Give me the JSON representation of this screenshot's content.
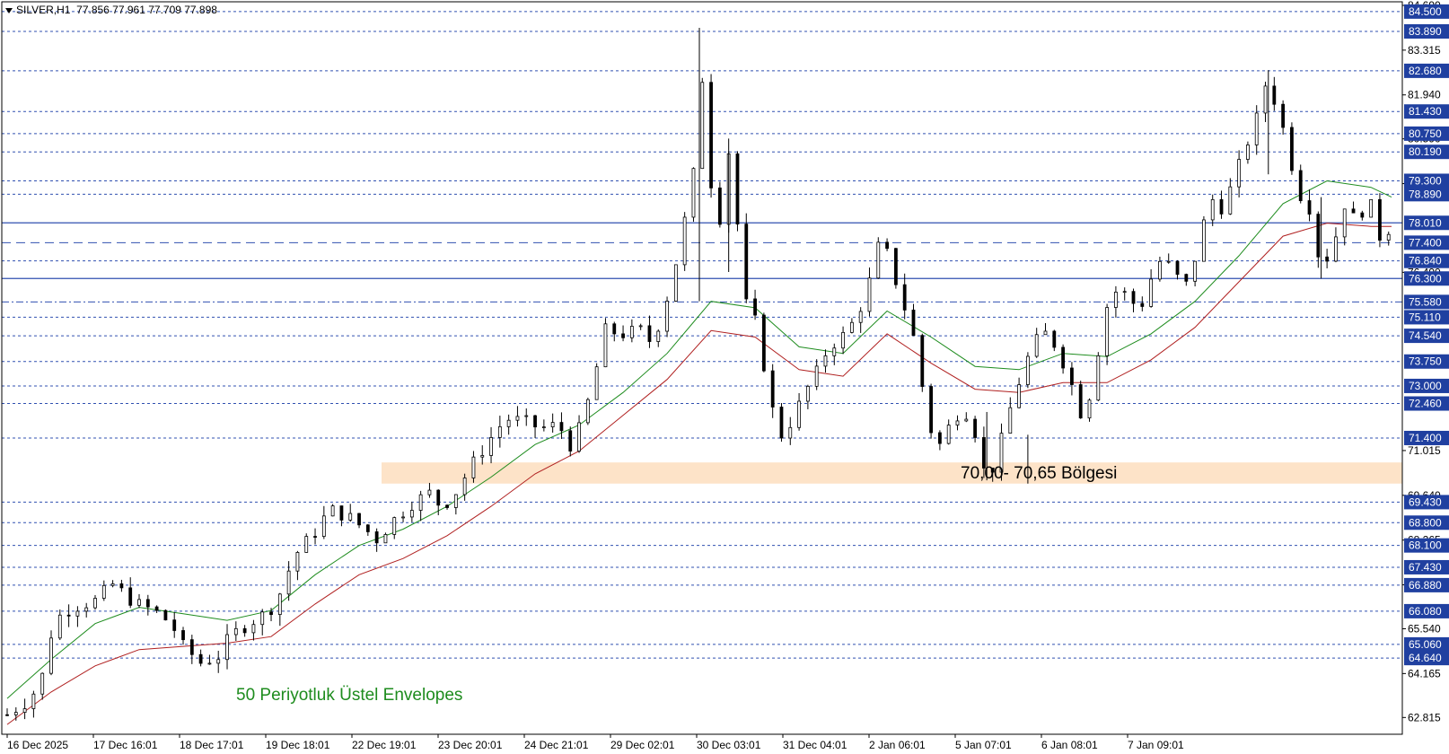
{
  "header": {
    "symbol": "SILVER,H1",
    "ohlc": "77.856 77.961 77.709 77.898"
  },
  "annotations": {
    "zone_label": "70,00- 70,65 Bölgesi",
    "envelope_label": "50 Periyotluk Üstel Envelopes"
  },
  "colors": {
    "grid_line": "#3050b0",
    "label_bg": "#2040a0",
    "zone_fill": "#fde3c8",
    "envelope_upper": "#1e8c1e",
    "envelope_lower": "#b02020",
    "candle": "#000000",
    "annotation_green": "#1e8c1e"
  },
  "chart_data": {
    "type": "candlestick",
    "instrument": "SILVER",
    "timeframe": "H1",
    "ylim": [
      62.3,
      84.8
    ],
    "x_ticks": [
      "16 Dec 2025",
      "17 Dec 16:01",
      "18 Dec 17:01",
      "19 Dec 18:01",
      "22 Dec 19:01",
      "23 Dec 20:01",
      "24 Dec 21:01",
      "29 Dec 02:01",
      "30 Dec 03:01",
      "31 Dec 04:01",
      "2 Jan 06:01",
      "5 Jan 07:01",
      "6 Jan 08:01",
      "7 Jan 09:01"
    ],
    "y_ticks": [
      "84.690",
      "83.315",
      "81.940",
      "80.590",
      "79.215",
      "76.490",
      "71.015",
      "69.640",
      "68.265",
      "66.890",
      "65.540",
      "64.165",
      "62.815"
    ],
    "level_labels": [
      "84.500",
      "83.890",
      "82.680",
      "81.430",
      "80.750",
      "80.190",
      "79.300",
      "78.890",
      "78.010",
      "77.400",
      "76.840",
      "76.300",
      "75.580",
      "75.110",
      "74.540",
      "73.750",
      "73.000",
      "72.460",
      "71.400",
      "69.430",
      "68.800",
      "68.100",
      "67.430",
      "66.880",
      "66.080",
      "65.060",
      "64.640"
    ],
    "dashed_levels": [
      84.5,
      83.89,
      82.68,
      81.43,
      80.75,
      80.19,
      79.3,
      78.89,
      77.4,
      76.84,
      75.58,
      75.11,
      74.54,
      73.75,
      73.0,
      72.46,
      71.4,
      69.43,
      68.8,
      68.1,
      67.43,
      66.88,
      66.08,
      65.06,
      64.64
    ],
    "solid_levels": [
      78.01,
      76.3
    ],
    "long_dash_levels": [
      77.4
    ],
    "dash_dot_levels": [
      75.58
    ],
    "support_zone": {
      "low": 70.0,
      "high": 70.65
    },
    "key_points": [
      [
        0,
        62.9
      ],
      [
        8,
        63.4
      ],
      [
        12,
        64.1
      ],
      [
        16,
        65.8
      ],
      [
        22,
        66.2
      ],
      [
        30,
        66.4
      ],
      [
        36,
        66.9
      ],
      [
        44,
        66.3
      ],
      [
        50,
        66.1
      ],
      [
        56,
        65.7
      ],
      [
        60,
        65.0
      ],
      [
        66,
        64.5
      ],
      [
        72,
        64.7
      ],
      [
        76,
        65.3
      ],
      [
        82,
        65.7
      ],
      [
        88,
        66.0
      ],
      [
        92,
        66.4
      ],
      [
        98,
        67.8
      ],
      [
        104,
        68.4
      ],
      [
        110,
        69.2
      ],
      [
        116,
        69.0
      ],
      [
        122,
        68.6
      ],
      [
        126,
        68.3
      ],
      [
        132,
        68.9
      ],
      [
        138,
        69.4
      ],
      [
        144,
        69.7
      ],
      [
        148,
        69.3
      ],
      [
        152,
        69.6
      ],
      [
        158,
        70.5
      ],
      [
        164,
        71.3
      ],
      [
        170,
        72.0
      ],
      [
        176,
        71.9
      ],
      [
        182,
        71.7
      ],
      [
        188,
        71.8
      ],
      [
        192,
        71.2
      ],
      [
        196,
        71.8
      ],
      [
        200,
        73.2
      ],
      [
        204,
        74.7
      ],
      [
        210,
        74.6
      ],
      [
        216,
        74.7
      ],
      [
        220,
        74.3
      ],
      [
        226,
        76.0
      ],
      [
        230,
        77.6
      ],
      [
        234,
        79.5
      ],
      [
        236,
        83.9
      ],
      [
        238,
        81.0
      ],
      [
        242,
        77.5
      ],
      [
        246,
        80.2
      ],
      [
        248,
        78.8
      ],
      [
        252,
        75.5
      ],
      [
        256,
        74.8
      ],
      [
        260,
        72.5
      ],
      [
        264,
        71.5
      ],
      [
        268,
        72.0
      ],
      [
        272,
        72.8
      ],
      [
        276,
        73.4
      ],
      [
        280,
        74.2
      ],
      [
        286,
        74.6
      ],
      [
        290,
        75.2
      ],
      [
        294,
        76.2
      ],
      [
        298,
        77.6
      ],
      [
        302,
        76.5
      ],
      [
        306,
        75.4
      ],
      [
        310,
        74.2
      ],
      [
        314,
        71.8
      ],
      [
        318,
        71.2
      ],
      [
        322,
        71.9
      ],
      [
        326,
        72.4
      ],
      [
        330,
        71.6
      ],
      [
        334,
        70.0
      ],
      [
        338,
        71.0
      ],
      [
        342,
        72.3
      ],
      [
        346,
        73.4
      ],
      [
        350,
        74.3
      ],
      [
        354,
        74.6
      ],
      [
        358,
        74.2
      ],
      [
        362,
        73.3
      ],
      [
        366,
        72.2
      ],
      [
        370,
        72.9
      ],
      [
        374,
        75.3
      ],
      [
        378,
        75.9
      ],
      [
        382,
        75.8
      ],
      [
        386,
        75.3
      ],
      [
        390,
        76.3
      ],
      [
        394,
        77.0
      ],
      [
        398,
        76.4
      ],
      [
        402,
        76.1
      ],
      [
        406,
        77.2
      ],
      [
        410,
        78.8
      ],
      [
        414,
        78.5
      ],
      [
        418,
        79.2
      ],
      [
        422,
        80.3
      ],
      [
        426,
        81.2
      ],
      [
        430,
        82.6
      ],
      [
        432,
        81.8
      ],
      [
        436,
        80.6
      ],
      [
        440,
        79.0
      ],
      [
        444,
        78.5
      ],
      [
        448,
        76.6
      ],
      [
        452,
        77.3
      ],
      [
        456,
        78.6
      ],
      [
        460,
        78.0
      ],
      [
        464,
        78.8
      ],
      [
        468,
        77.6
      ],
      [
        472,
        77.9
      ]
    ],
    "envelope_upper_points": [
      [
        0,
        63.4
      ],
      [
        15,
        64.6
      ],
      [
        30,
        65.7
      ],
      [
        45,
        66.2
      ],
      [
        60,
        66.0
      ],
      [
        75,
        65.8
      ],
      [
        90,
        66.1
      ],
      [
        105,
        67.2
      ],
      [
        120,
        68.1
      ],
      [
        135,
        68.6
      ],
      [
        150,
        69.3
      ],
      [
        165,
        70.2
      ],
      [
        180,
        71.2
      ],
      [
        195,
        71.8
      ],
      [
        210,
        72.8
      ],
      [
        225,
        74.0
      ],
      [
        240,
        75.6
      ],
      [
        255,
        75.4
      ],
      [
        270,
        74.2
      ],
      [
        285,
        74.0
      ],
      [
        300,
        75.3
      ],
      [
        315,
        74.5
      ],
      [
        330,
        73.6
      ],
      [
        345,
        73.5
      ],
      [
        360,
        74.0
      ],
      [
        375,
        73.9
      ],
      [
        390,
        74.6
      ],
      [
        405,
        75.6
      ],
      [
        420,
        77.0
      ],
      [
        435,
        78.6
      ],
      [
        450,
        79.3
      ],
      [
        465,
        79.1
      ],
      [
        472,
        78.8
      ]
    ],
    "envelope_lower_points": [
      [
        0,
        62.6
      ],
      [
        15,
        63.6
      ],
      [
        30,
        64.4
      ],
      [
        45,
        64.9
      ],
      [
        60,
        65.0
      ],
      [
        75,
        65.1
      ],
      [
        90,
        65.3
      ],
      [
        105,
        66.3
      ],
      [
        120,
        67.2
      ],
      [
        135,
        67.7
      ],
      [
        150,
        68.4
      ],
      [
        165,
        69.3
      ],
      [
        180,
        70.3
      ],
      [
        195,
        71.0
      ],
      [
        210,
        72.1
      ],
      [
        225,
        73.2
      ],
      [
        240,
        74.7
      ],
      [
        255,
        74.5
      ],
      [
        270,
        73.5
      ],
      [
        285,
        73.3
      ],
      [
        300,
        74.6
      ],
      [
        315,
        73.7
      ],
      [
        330,
        72.9
      ],
      [
        345,
        72.8
      ],
      [
        360,
        73.1
      ],
      [
        375,
        73.1
      ],
      [
        390,
        73.8
      ],
      [
        405,
        74.8
      ],
      [
        420,
        76.2
      ],
      [
        435,
        77.6
      ],
      [
        450,
        78.0
      ],
      [
        465,
        77.9
      ],
      [
        472,
        77.9
      ]
    ]
  }
}
